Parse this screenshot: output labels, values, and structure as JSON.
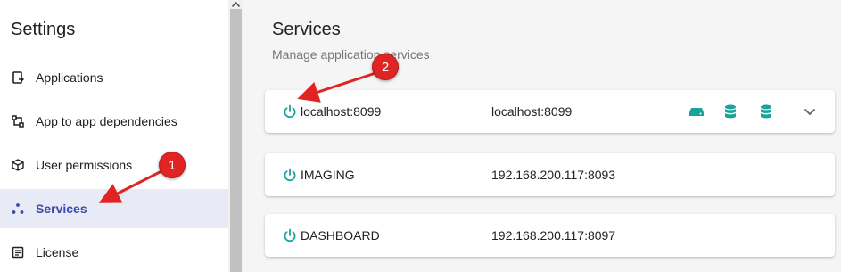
{
  "sidebar": {
    "title": "Settings",
    "items": [
      {
        "label": "Applications",
        "icon": "application-icon"
      },
      {
        "label": "App to app dependencies",
        "icon": "dependencies-icon"
      },
      {
        "label": "User permissions",
        "icon": "cube-icon"
      },
      {
        "label": "Services",
        "icon": "services-icon",
        "active": true
      },
      {
        "label": "License",
        "icon": "license-icon"
      }
    ]
  },
  "main": {
    "title": "Services",
    "subtitle": "Manage application services",
    "services": [
      {
        "name": "localhost:8099",
        "address": "localhost:8099",
        "has_actions": true
      },
      {
        "name": "IMAGING",
        "address": "192.168.200.117:8093"
      },
      {
        "name": "DASHBOARD",
        "address": "192.168.200.117:8097"
      }
    ]
  },
  "annotations": {
    "badge1": "1",
    "badge2": "2"
  },
  "colors": {
    "accent": "#3949ab",
    "active_bg": "#e8eaf6",
    "teal": "#1aa39a",
    "annotation_red": "#e02424"
  }
}
